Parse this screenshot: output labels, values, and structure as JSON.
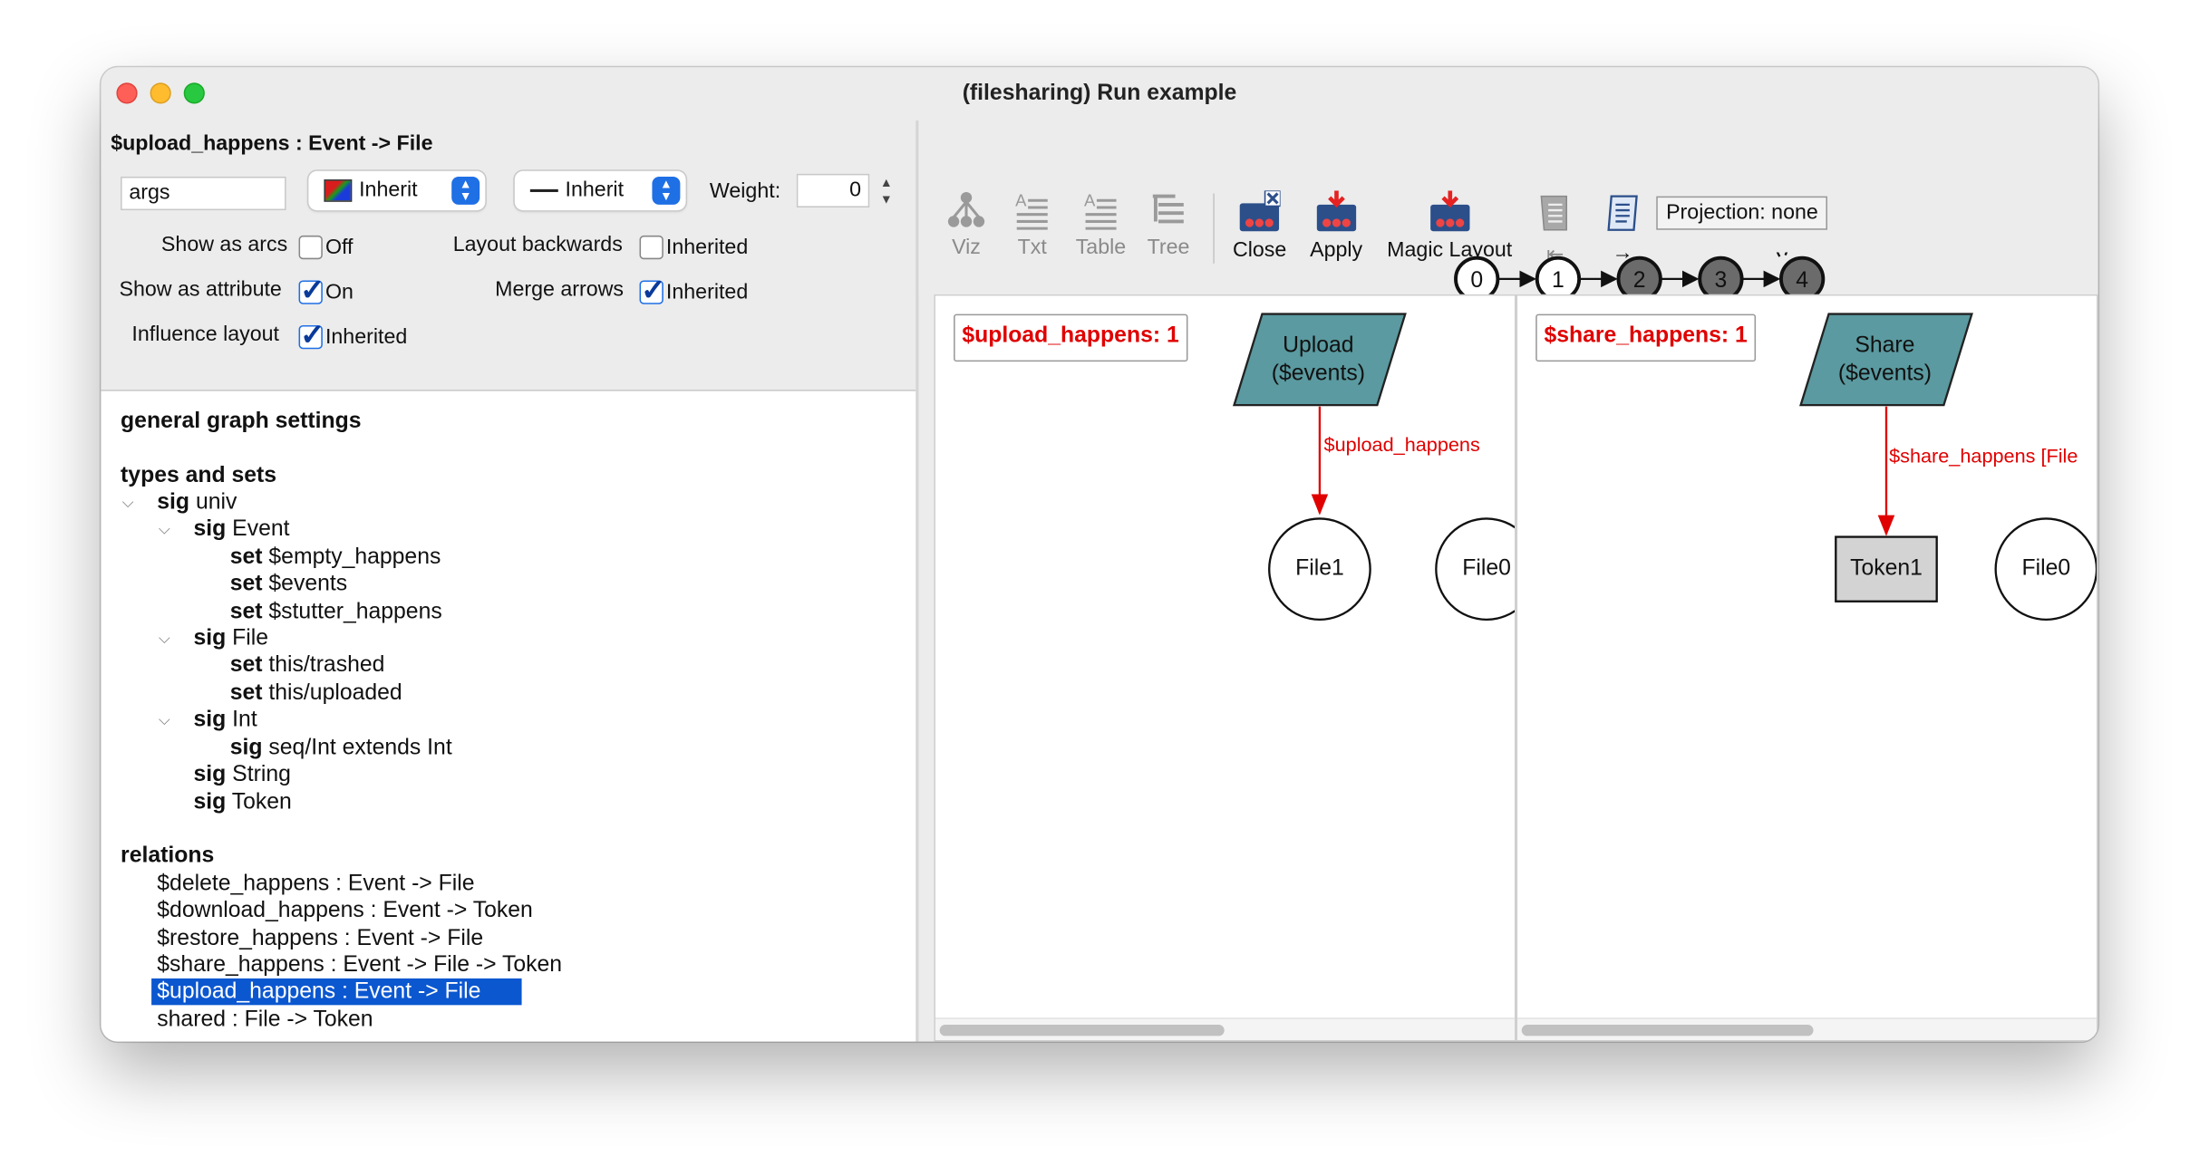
{
  "window": {
    "title": "(filesharing) Run example"
  },
  "settings": {
    "relation_title": "$upload_happens : Event -> File",
    "label_input_value": "args",
    "color_popup": "Inherit",
    "style_popup": "Inherit",
    "weight_label": "Weight:",
    "weight_value": "0",
    "show_as_arcs": {
      "label": "Show as arcs",
      "value": "Off"
    },
    "show_as_attribute": {
      "label": "Show as attribute",
      "value": "On"
    },
    "influence_layout": {
      "label": "Influence layout",
      "value": "Inherited"
    },
    "layout_backwards": {
      "label": "Layout backwards",
      "value": "Inherited"
    },
    "merge_arrows": {
      "label": "Merge arrows",
      "value": "Inherited"
    }
  },
  "tree": {
    "general": "general graph settings",
    "types_header": "types and sets",
    "sig_kw": "sig",
    "set_kw": "set",
    "univ": "univ",
    "event": "Event",
    "event_sets": [
      "$empty_happens",
      "$events",
      "$stutter_happens"
    ],
    "file": "File",
    "file_sets": [
      "this/trashed",
      "this/uploaded"
    ],
    "int": "Int",
    "seq_int": "seq/Int extends Int",
    "string": "String",
    "token": "Token",
    "relations_header": "relations",
    "relations": [
      "$delete_happens :  Event -> File",
      "$download_happens :  Event -> Token",
      "$restore_happens :  Event -> File",
      "$share_happens :  Event -> File -> Token",
      "$upload_happens :  Event -> File",
      "shared :  File -> Token"
    ]
  },
  "toolbar": {
    "viz": "Viz",
    "txt": "Txt",
    "table": "Table",
    "tree": "Tree",
    "close": "Close",
    "apply": "Apply",
    "magic_layout": "Magic Layout",
    "first": "⇤",
    "next": "→",
    "projection": "Projection: none"
  },
  "timeline": {
    "states": [
      "0",
      "1",
      "2",
      "3",
      "4"
    ],
    "current": 1
  },
  "panels": {
    "left": {
      "state_label": "$upload_happens: 1",
      "event_node": "Upload\n($events)",
      "edge_label": "$upload_happens",
      "target": "File1",
      "other": "File0"
    },
    "right": {
      "state_label": "$share_happens: 1",
      "event_node": "Share\n($events)",
      "edge_label": "$share_happens [File",
      "target": "Token1",
      "other": "File0"
    }
  },
  "colors": {
    "accent": "#1f6fe5",
    "selection": "#0b57d0",
    "event_node": "#5a9aa0",
    "relation_red": "#e00000",
    "token_fill": "#d3d3d3",
    "state_filled": "#6b6b6b"
  }
}
